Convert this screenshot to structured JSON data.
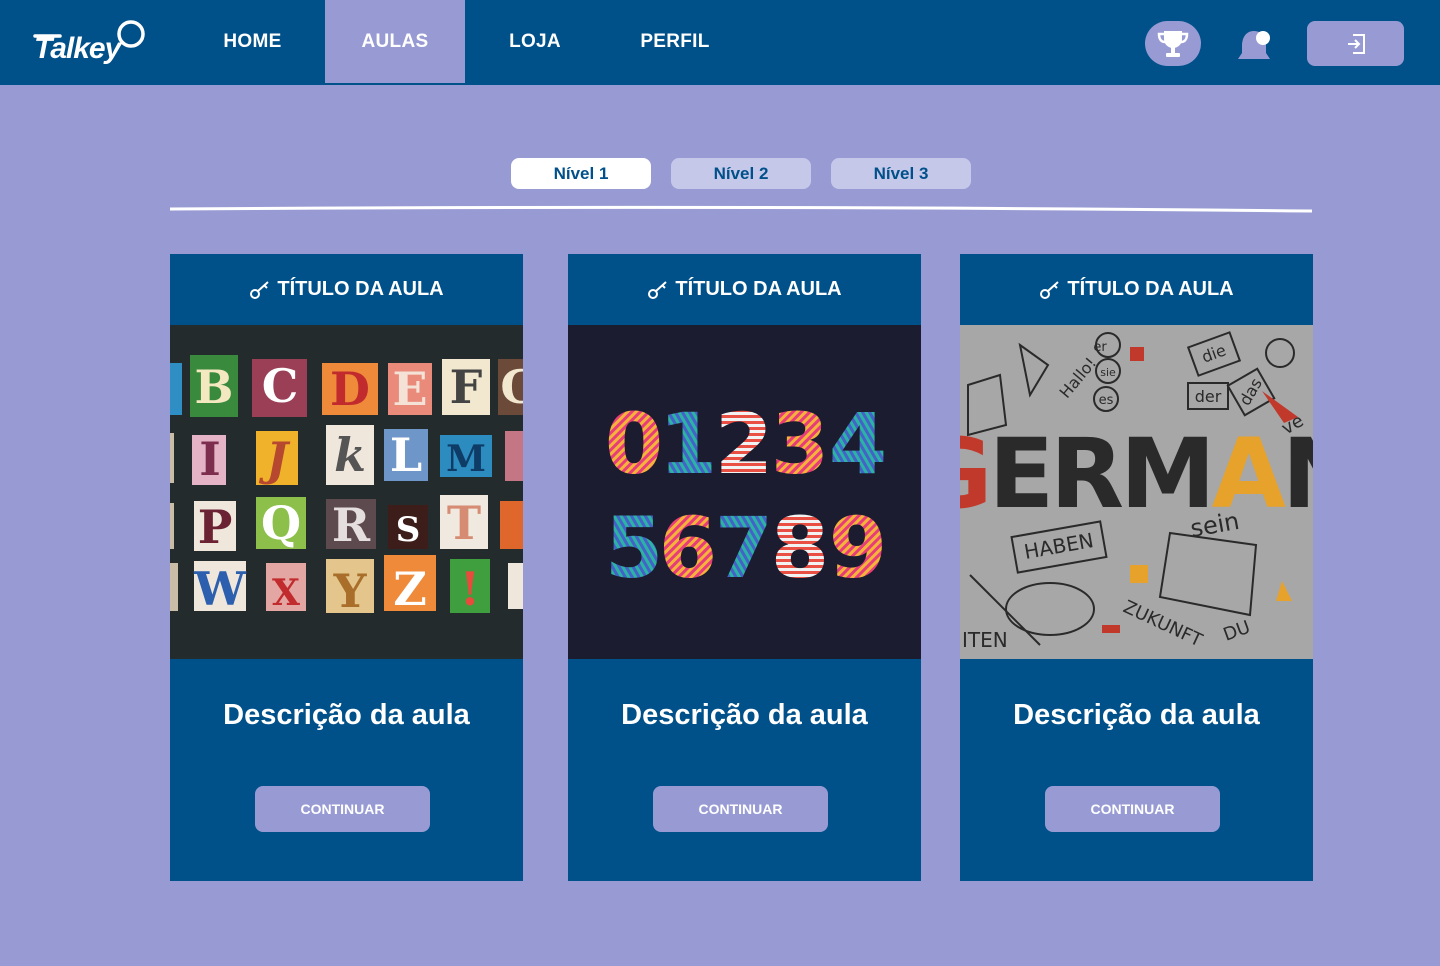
{
  "app": {
    "logo_text": "Talkey"
  },
  "nav": {
    "tabs": [
      {
        "label": "HOME"
      },
      {
        "label": "AULAS",
        "active": true
      },
      {
        "label": "LOJA"
      },
      {
        "label": "PERFIL"
      }
    ],
    "icons": {
      "trophy": "trophy-icon",
      "bell": "bell-icon",
      "logout": "logout-icon"
    }
  },
  "levels": [
    {
      "label": "Nível 1",
      "active": true
    },
    {
      "label": "Nível 2"
    },
    {
      "label": "Nível 3"
    }
  ],
  "cards": [
    {
      "title": "TÍTULO DA AULA",
      "description": "Descrição da aula",
      "button": "CONTINUAR",
      "image": "alphabet-letters-image"
    },
    {
      "title": "TÍTULO DA AULA",
      "description": "Descrição da aula",
      "button": "CONTINUAR",
      "image": "colorful-numbers-image"
    },
    {
      "title": "TÍTULO DA AULA",
      "description": "Descrição da aula",
      "button": "CONTINUAR",
      "image": "german-doodles-image",
      "image_text": {
        "main": "GERMAN",
        "words": [
          "Hallo!",
          "er",
          "sie",
          "es",
          "die",
          "der",
          "das",
          "HABEN",
          "sein",
          "ZUKUNFT",
          "DU",
          "ITEN",
          "ve"
        ]
      }
    }
  ],
  "colors": {
    "primary": "#005089",
    "lavender": "#989bd3",
    "pill": "#c6c8ea"
  }
}
